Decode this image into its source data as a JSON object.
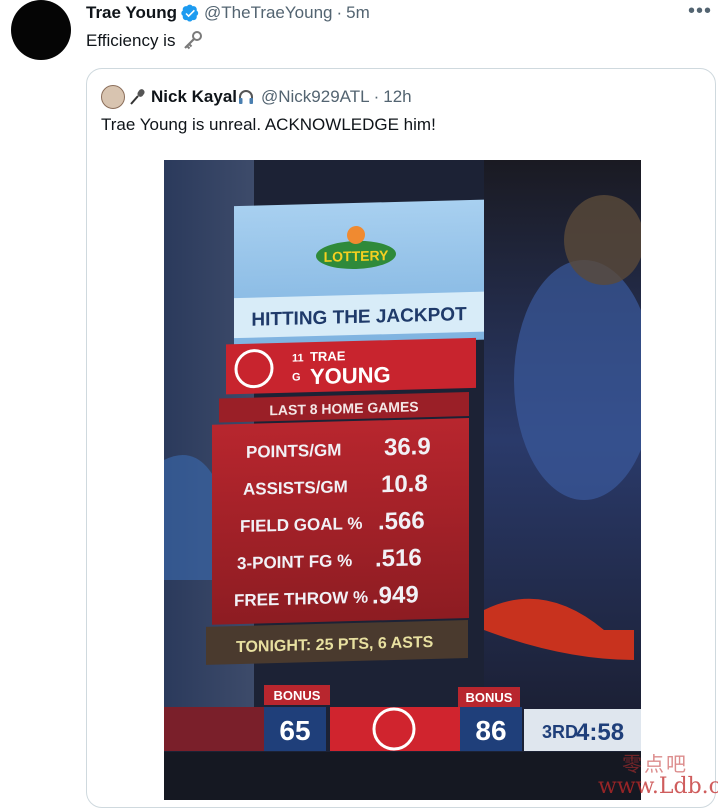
{
  "tweet": {
    "author_name": "Trae Young",
    "author_handle": "@TheTraeYoung",
    "time": "5m",
    "text": "Efficiency is",
    "text_emoji": "key-icon",
    "more_icon": "more-icon"
  },
  "quoted_tweet": {
    "author_name": "Nick Kayal",
    "author_handle": "@Nick929ATL",
    "time": "12h",
    "text": "Trae Young is unreal. ACKNOWLEDGE him!",
    "name_emojis": [
      "microphone-icon",
      "headphones-icon"
    ]
  },
  "graphic": {
    "sponsor": "LOTTERY",
    "title": "HITTING THE JACKPOT",
    "player_number": "11",
    "player_position": "G",
    "player_first": "TRAE",
    "player_last": "YOUNG",
    "subtitle": "LAST 8 HOME GAMES",
    "stats": [
      {
        "label": "POINTS/GM",
        "value": "36.9"
      },
      {
        "label": "ASSISTS/GM",
        "value": "10.8"
      },
      {
        "label": "FIELD GOAL %",
        "value": ".566"
      },
      {
        "label": "3-POINT FG %",
        "value": ".516"
      },
      {
        "label": "FREE THROW %",
        "value": ".949"
      }
    ],
    "tonight": "TONIGHT: 25 PTS, 6 ASTS"
  },
  "scoreboard": {
    "away_bonus": "BONUS",
    "away_score": "65",
    "home_bonus": "BONUS",
    "home_score": "86",
    "period": "3RD",
    "clock": "4:58"
  },
  "watermark": {
    "cn": "零点吧",
    "en": "www.Ldb.cc"
  },
  "colors": {
    "verified": "#1d9bf0",
    "hawks_red": "#c8102e",
    "graphic_red": "#a5222a",
    "graphic_blue": "#8ab8e0"
  }
}
